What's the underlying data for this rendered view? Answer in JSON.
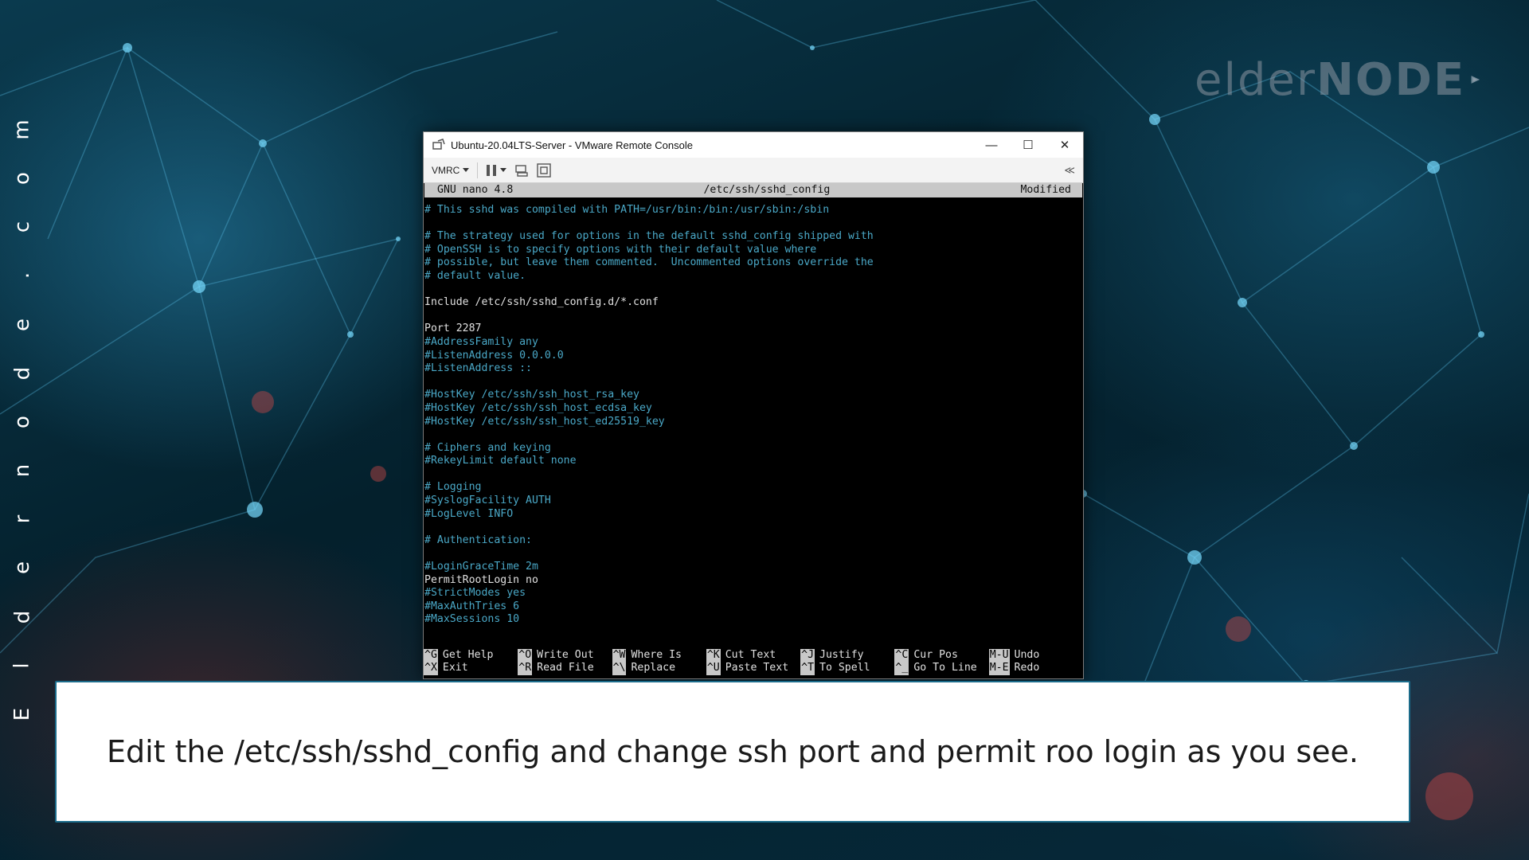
{
  "branding": {
    "side_text": [
      "E",
      "l",
      "d",
      "e",
      "r",
      "n",
      "o",
      "d",
      "e",
      ".",
      "c",
      "o",
      "m"
    ],
    "logo_light": "elder",
    "logo_bold": "NODE"
  },
  "window": {
    "title": "Ubuntu-20.04LTS-Server - VMware Remote Console",
    "minimize_glyph": "—",
    "maximize_glyph": "☐",
    "close_glyph": "✕",
    "toolbar": {
      "vmrc_label": "VMRC",
      "collapse_glyph": "≪"
    }
  },
  "nano": {
    "version": "GNU nano 4.8",
    "filename": "/etc/ssh/sshd_config",
    "status": "Modified",
    "lines": [
      {
        "text": "# This sshd was compiled with PATH=/usr/bin:/bin:/usr/sbin:/sbin",
        "type": "comment"
      },
      {
        "text": "",
        "type": "normal"
      },
      {
        "text": "# The strategy used for options in the default sshd_config shipped with",
        "type": "comment"
      },
      {
        "text": "# OpenSSH is to specify options with their default value where",
        "type": "comment"
      },
      {
        "text": "# possible, but leave them commented.  Uncommented options override the",
        "type": "comment"
      },
      {
        "text": "# default value.",
        "type": "comment"
      },
      {
        "text": "",
        "type": "normal"
      },
      {
        "text": "Include /etc/ssh/sshd_config.d/*.conf",
        "type": "normal"
      },
      {
        "text": "",
        "type": "normal"
      },
      {
        "text": "Port 2287",
        "type": "normal"
      },
      {
        "text": "#AddressFamily any",
        "type": "comment"
      },
      {
        "text": "#ListenAddress 0.0.0.0",
        "type": "comment"
      },
      {
        "text": "#ListenAddress ::",
        "type": "comment"
      },
      {
        "text": "",
        "type": "normal"
      },
      {
        "text": "#HostKey /etc/ssh/ssh_host_rsa_key",
        "type": "comment"
      },
      {
        "text": "#HostKey /etc/ssh/ssh_host_ecdsa_key",
        "type": "comment"
      },
      {
        "text": "#HostKey /etc/ssh/ssh_host_ed25519_key",
        "type": "comment"
      },
      {
        "text": "",
        "type": "normal"
      },
      {
        "text": "# Ciphers and keying",
        "type": "comment"
      },
      {
        "text": "#RekeyLimit default none",
        "type": "comment"
      },
      {
        "text": "",
        "type": "normal"
      },
      {
        "text": "# Logging",
        "type": "comment"
      },
      {
        "text": "#SyslogFacility AUTH",
        "type": "comment"
      },
      {
        "text": "#LogLevel INFO",
        "type": "comment"
      },
      {
        "text": "",
        "type": "normal"
      },
      {
        "text": "# Authentication:",
        "type": "comment"
      },
      {
        "text": "",
        "type": "normal"
      },
      {
        "text": "#LoginGraceTime 2m",
        "type": "comment"
      },
      {
        "text": "PermitRootLogin no",
        "type": "normal"
      },
      {
        "text": "#StrictModes yes",
        "type": "comment"
      },
      {
        "text": "#MaxAuthTries 6",
        "type": "comment"
      },
      {
        "text": "#MaxSessions 10",
        "type": "comment"
      }
    ],
    "shortcuts": [
      {
        "key": "^G",
        "label": "Get Help"
      },
      {
        "key": "^O",
        "label": "Write Out"
      },
      {
        "key": "^W",
        "label": "Where Is"
      },
      {
        "key": "^K",
        "label": "Cut Text"
      },
      {
        "key": "^J",
        "label": "Justify"
      },
      {
        "key": "^C",
        "label": "Cur Pos"
      },
      {
        "key": "M-U",
        "label": "Undo"
      },
      {
        "key": "^X",
        "label": "Exit"
      },
      {
        "key": "^R",
        "label": "Read File"
      },
      {
        "key": "^\\",
        "label": "Replace"
      },
      {
        "key": "^U",
        "label": "Paste Text"
      },
      {
        "key": "^T",
        "label": "To Spell"
      },
      {
        "key": "^_",
        "label": "Go To Line"
      },
      {
        "key": "M-E",
        "label": "Redo"
      }
    ]
  },
  "caption": {
    "text": "Edit the /etc/ssh/sshd_config and change ssh port and permit roo login as you see."
  },
  "colors": {
    "comment": "#4aa8c7",
    "terminal_bg": "#000000",
    "caption_border": "#1b6b8a"
  }
}
